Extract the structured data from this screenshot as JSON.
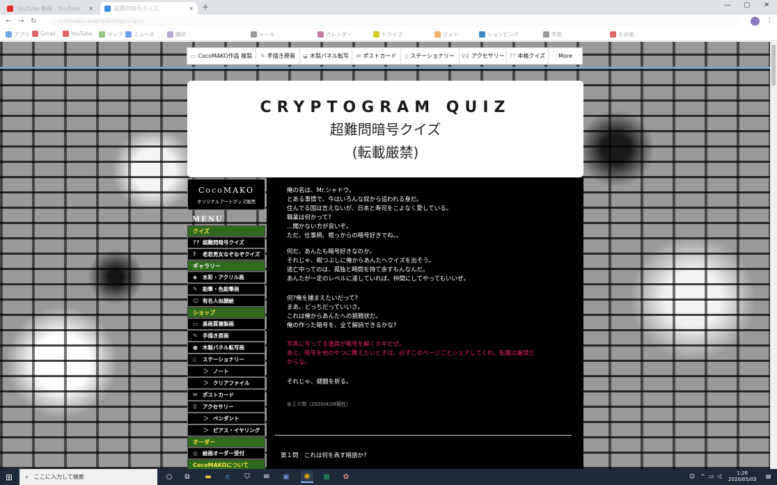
{
  "browser": {
    "tabs": [
      {
        "label": "YouTube 動画 - YouTube",
        "active": false
      },
      {
        "label": "超難問暗号クイズ",
        "active": true
      }
    ],
    "url": "cocomako.example/angou-quiz",
    "bookmarks": [
      "アプリ",
      "Gmail",
      "YouTube",
      "マップ",
      "ニュース",
      "翻訳",
      "メール",
      "カレンダー",
      "ドライブ",
      "フォト",
      "ショッピング",
      "天気",
      "その他"
    ]
  },
  "topnav": [
    {
      "icon": "▭",
      "label": "CocoMAKO作品 複製"
    },
    {
      "icon": "✎",
      "label": "手描き原画"
    },
    {
      "icon": "◒",
      "label": "木製パネル転写"
    },
    {
      "icon": "✉",
      "label": "ポストカード"
    },
    {
      "icon": "▯",
      "label": "ステーショナリー"
    },
    {
      "icon": "♀♀",
      "label": "アクセサリー"
    },
    {
      "icon": "??",
      "label": "本格クイズ"
    },
    {
      "icon": "",
      "label": "More"
    }
  ],
  "header": {
    "title": "CRYPTOGRAM QUIZ",
    "subtitle": "超難問暗号クイズ",
    "note": "(転載厳禁)"
  },
  "logo": {
    "name": "CocoMAKO",
    "tagline": "オリジナルアートグッズ販売"
  },
  "menu_label": "MENU",
  "sidebar": [
    {
      "type": "section",
      "label": "クイズ",
      "color": "yellow"
    },
    {
      "type": "item",
      "icon": "??",
      "label": "超難問暗号クイズ"
    },
    {
      "type": "item",
      "icon": "?",
      "label": "老若男女なぞなぞクイズ"
    },
    {
      "type": "section",
      "label": "ギャラリー",
      "color": "white"
    },
    {
      "type": "item",
      "icon": "◆",
      "label": "水彩・アクリル画"
    },
    {
      "type": "item",
      "icon": "✎",
      "label": "鉛筆・色鉛筆画"
    },
    {
      "type": "item",
      "icon": "☺",
      "label": "有名人似顔絵"
    },
    {
      "type": "section",
      "label": "ショップ",
      "color": "yellow"
    },
    {
      "type": "item",
      "icon": "▭",
      "label": "高画質複製画"
    },
    {
      "type": "item",
      "icon": "✎",
      "label": "手描き原画"
    },
    {
      "type": "item",
      "icon": "●",
      "label": "木製パネル転写画"
    },
    {
      "type": "item",
      "icon": "▯",
      "label": "ステーショナリー"
    },
    {
      "type": "sub",
      "icon": "＞",
      "label": "ノート"
    },
    {
      "type": "sub",
      "icon": "＞",
      "label": "クリアファイル"
    },
    {
      "type": "item",
      "icon": "✉",
      "label": "ポストカード"
    },
    {
      "type": "item",
      "icon": "♀",
      "label": "アクセサリー"
    },
    {
      "type": "sub",
      "icon": "＞",
      "label": "ペンダント"
    },
    {
      "type": "sub",
      "icon": "＞",
      "label": "ピアス・イヤリング"
    },
    {
      "type": "section",
      "label": "オーダー",
      "color": "yellow"
    },
    {
      "type": "item",
      "icon": "◎",
      "label": "絵画オーダー受付"
    },
    {
      "type": "section",
      "label": "CocoMAKOについて",
      "color": "yellow"
    }
  ],
  "content": {
    "para1": [
      "俺の名は、Mr.シャドウ。",
      "とある事情で、今はいろんな奴から追われる身だ。",
      "住んでる国は言えないが、日本と寿司をこよなく愛している。",
      "職業は何かって?",
      "…聞かない方が良いぞ。",
      "ただ、仕事柄、根っからの暗号好きでね。。"
    ],
    "para2": [
      "何だ、あんたも暗号好きなのか。",
      "それじゃ、暇つぶしに俺からあんたへクイズを出そう。",
      "逃亡中ってのは、孤独と時間を持て余すもんなんだ。",
      "あんたが一定のレベルに達していれば、仲間にしてやってもいいぜ。"
    ],
    "para3": [
      "何?俺を捕まえたいだって?",
      "まあ、どっちだっていいさ。",
      "これは俺からあんたへの挑戦状だ。",
      "俺の作った暗号を、全て解読できるかな?"
    ],
    "para4": [
      "写真に写ってる道具が暗号を解くカギだぜ。",
      "あと、暗号を他のやつに教えたいときは、必ずこのページごとシェアしてくれ。転載は厳禁だ",
      "からな。"
    ],
    "para5": [
      "それじゃ、健闘を祈る。"
    ],
    "count": "全２０問（2020/4/28現在）",
    "question1": "第１問　これは何を表す暗語か?"
  },
  "taskbar": {
    "search_placeholder": "ここに入力して検索",
    "time": "1:26",
    "date": "2020/05/03"
  }
}
